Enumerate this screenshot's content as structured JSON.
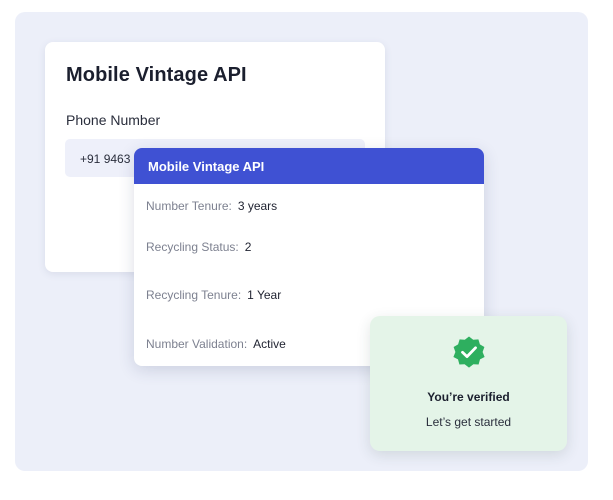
{
  "form": {
    "title": "Mobile Vintage API",
    "phone_label": "Phone Number",
    "phone_value": "+91 9463"
  },
  "result": {
    "header": "Mobile Vintage API",
    "rows": [
      {
        "key": "Number Tenure:",
        "value": "3 years"
      },
      {
        "key": "Recycling Status:",
        "value": "2"
      },
      {
        "key": "Recycling Tenure:",
        "value": "1 Year"
      },
      {
        "key": "Number Validation:",
        "value": "Active"
      }
    ]
  },
  "verified": {
    "icon": "check-badge-icon",
    "title": "You’re verified",
    "subtitle": "Let’s get started"
  },
  "colors": {
    "backdrop": "#eceff9",
    "header": "#3f51d3",
    "verified_bg": "#e4f4e8",
    "badge": "#2eaf5f"
  }
}
